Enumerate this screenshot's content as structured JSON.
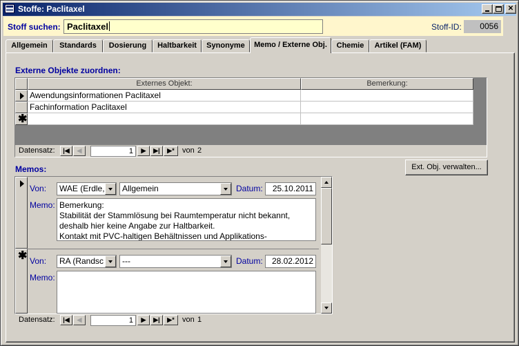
{
  "window": {
    "title": "Stoffe: Paclitaxel"
  },
  "header": {
    "search_label": "Stoff suchen:",
    "search_value": "Paclitaxel",
    "id_label": "Stoff-ID:",
    "id_value": "0056"
  },
  "tabs": [
    {
      "label": "Allgemein"
    },
    {
      "label": "Standards"
    },
    {
      "label": "Dosierung"
    },
    {
      "label": "Haltbarkeit"
    },
    {
      "label": "Synonyme"
    },
    {
      "label": "Memo / Externe Obj."
    },
    {
      "label": "Chemie"
    },
    {
      "label": "Artikel (FAM)"
    }
  ],
  "active_tab": "Memo / Externe Obj.",
  "external": {
    "title": "Externe Objekte zuordnen:",
    "columns": [
      "Externes Objekt:",
      "Bemerkung:"
    ],
    "rows": [
      {
        "object": "Awendungsinformationen Paclitaxel",
        "note": ""
      },
      {
        "object": "Fachinformation Paclitaxel",
        "note": ""
      }
    ],
    "nav": {
      "label": "Datensatz:",
      "current": "1",
      "of_label": "von",
      "total": "2"
    }
  },
  "manage_button": "Ext. Obj. verwalten...",
  "memos": {
    "title": "Memos:",
    "labels": {
      "from": "Von:",
      "date": "Datum:",
      "memo": "Memo:"
    },
    "records": [
      {
        "author": "WAE (Erdle,",
        "category": "Allgemein",
        "date": "25.10.2011",
        "memo_lines": [
          "Bemerkung:",
          "Stabilität der Stammlösung bei Raumtemperatur nicht bekannt,",
          "deshalb hier keine Angabe zur Haltbarkeit.",
          "Kontakt mit PVC-haltigen Behältnissen und Applikations-"
        ]
      },
      {
        "author": "RA (Randsc",
        "category": "---",
        "date": "28.02.2012",
        "memo_lines": []
      }
    ],
    "nav": {
      "label": "Datensatz:",
      "current": "1",
      "of_label": "von",
      "total": "1"
    }
  },
  "nav_glyphs": {
    "first": "|◀",
    "prev": "◀",
    "next": "▶",
    "last": "▶|",
    "new": "▶*"
  }
}
